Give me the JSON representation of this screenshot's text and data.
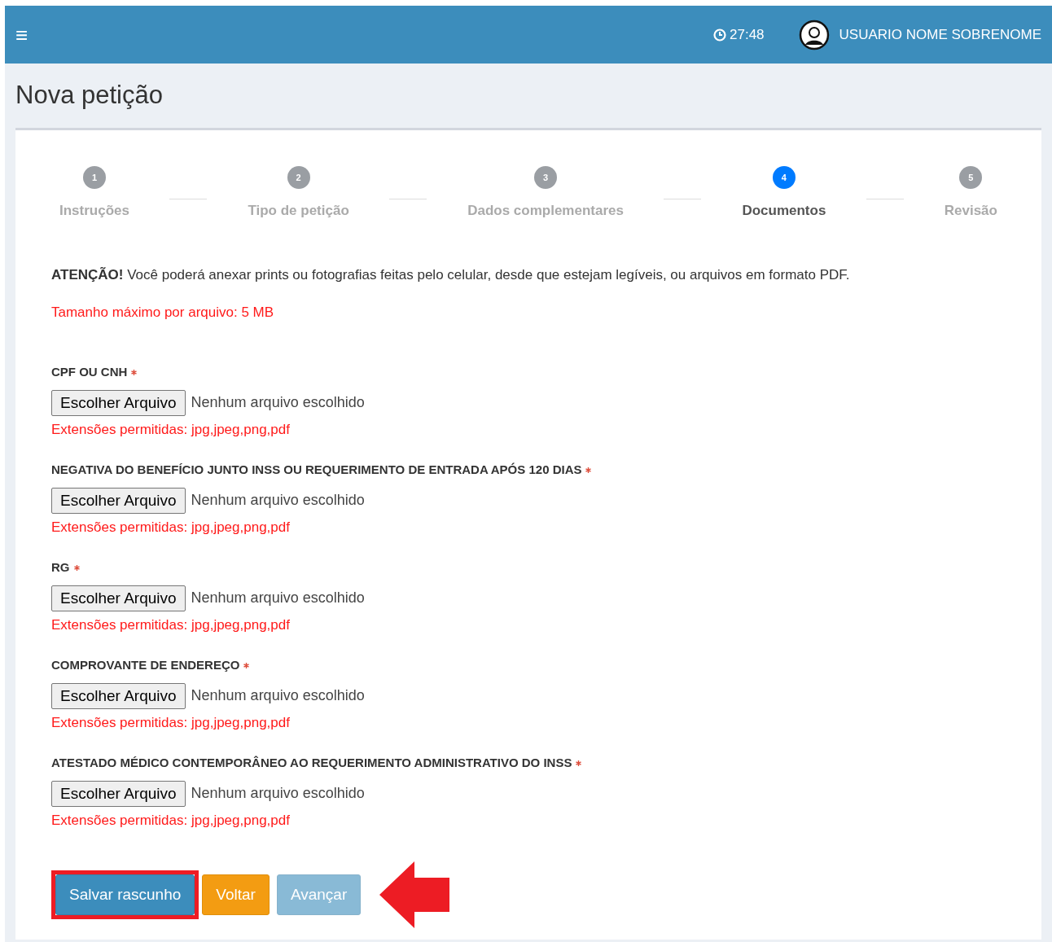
{
  "header": {
    "menu_icon": "≡",
    "timer": "27:48",
    "user_name": "USUARIO NOME SOBRENOME"
  },
  "page_title": "Nova petição",
  "steps": [
    {
      "number": "1",
      "label": "Instruções",
      "selected": false
    },
    {
      "number": "2",
      "label": "Tipo de petição",
      "selected": false
    },
    {
      "number": "3",
      "label": "Dados complementares",
      "selected": false
    },
    {
      "number": "4",
      "label": "Documentos",
      "selected": true
    },
    {
      "number": "5",
      "label": "Revisão",
      "selected": false
    }
  ],
  "notice": "**ATENÇÃO!** Você poderá anexar prints ou fotografias feitas pelo celular, desde que estejam legíveis, ou arquivos em formato PDF.",
  "max_size": "Tamanho máximo por arquivo: 5 MB",
  "documents": [
    {
      "label": "CPF OU CNH",
      "required": true,
      "button": "Escolher Arquivo",
      "file_status": "Nenhum arquivo escolhido",
      "hint": "Extensões permitidas: jpg,jpeg,png,pdf"
    },
    {
      "label": "NEGATIVA DO BENEFÍCIO JUNTO INSS OU REQUERIMENTO DE ENTRADA APÓS 120 DIAS",
      "required": true,
      "button": "Escolher Arquivo",
      "file_status": "Nenhum arquivo escolhido",
      "hint": "Extensões permitidas: jpg,jpeg,png,pdf"
    },
    {
      "label": "RG",
      "required": true,
      "button": "Escolher Arquivo",
      "file_status": "Nenhum arquivo escolhido",
      "hint": "Extensões permitidas: jpg,jpeg,png,pdf"
    },
    {
      "label": "COMPROVANTE DE ENDEREÇO",
      "required": true,
      "button": "Escolher Arquivo",
      "file_status": "Nenhum arquivo escolhido",
      "hint": "Extensões permitidas: jpg,jpeg,png,pdf"
    },
    {
      "label": "ATESTADO MÉDICO CONTEMPORÂNEO AO REQUERIMENTO ADMINISTRATIVO DO INSS",
      "required": true,
      "button": "Escolher Arquivo",
      "file_status": "Nenhum arquivo escolhido",
      "hint": "Extensões permitidas: jpg,jpeg,png,pdf"
    }
  ],
  "actions": [
    {
      "label": "Salvar rascunho",
      "kind": "primary",
      "disabled": false,
      "highlighted": true
    },
    {
      "label": "Voltar",
      "kind": "warning",
      "disabled": false,
      "highlighted": false
    },
    {
      "label": "Avançar",
      "kind": "primary",
      "disabled": true,
      "highlighted": false
    }
  ]
}
